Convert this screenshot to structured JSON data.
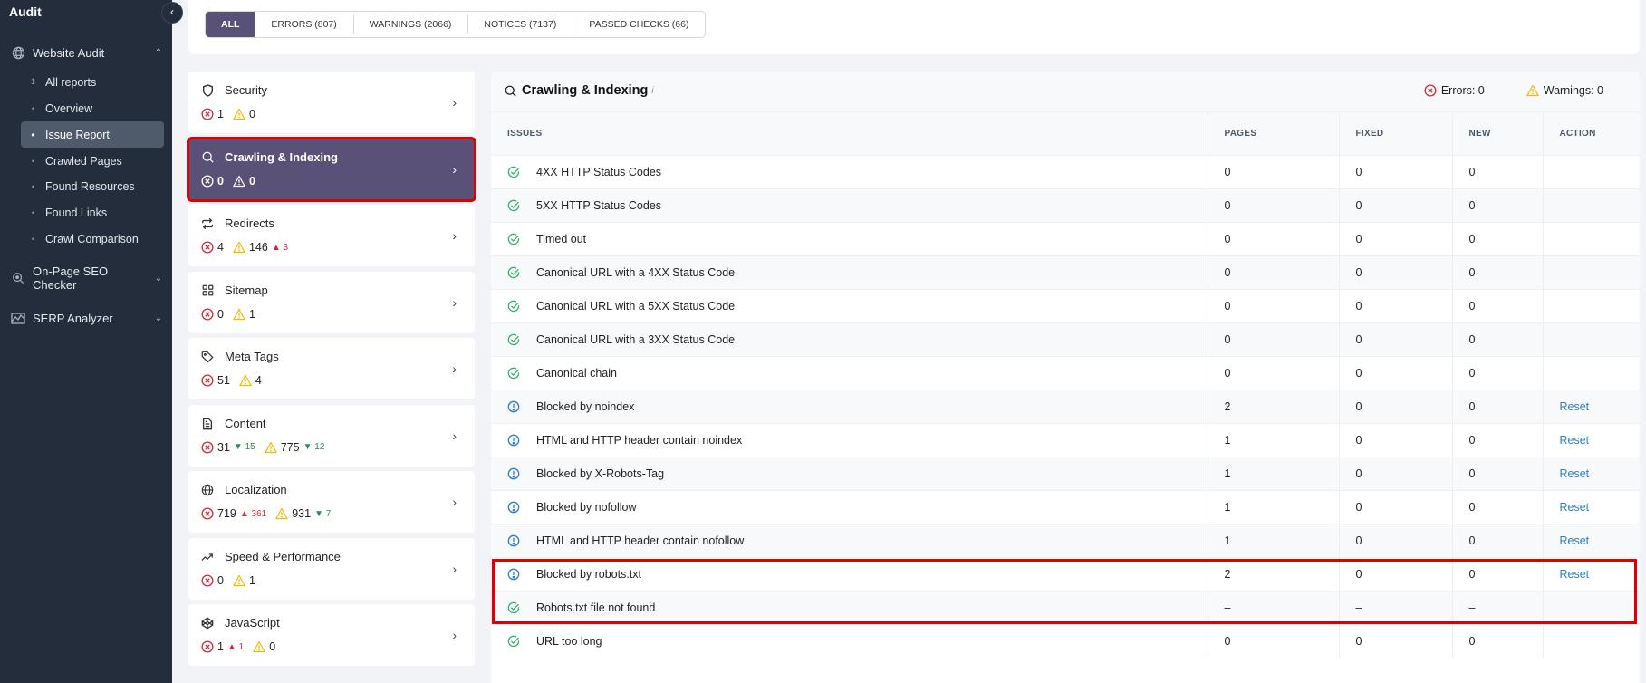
{
  "sidebar": {
    "brand": "Audit",
    "collapse_icon": "chevron-left",
    "groups": [
      {
        "label": "Website Audit",
        "icon": "globe",
        "expanded": true
      },
      {
        "label": "On-Page SEO Checker",
        "icon": "search-zoom",
        "expanded": false
      },
      {
        "label": "SERP Analyzer",
        "icon": "chart-mountain",
        "expanded": false
      }
    ],
    "items": [
      {
        "label": "All reports",
        "bullet": "↑"
      },
      {
        "label": "Overview",
        "bullet": "·"
      },
      {
        "label": "Issue Report",
        "bullet": "•",
        "active": true
      },
      {
        "label": "Crawled Pages",
        "bullet": "·"
      },
      {
        "label": "Found Resources",
        "bullet": "·"
      },
      {
        "label": "Found Links",
        "bullet": "·"
      },
      {
        "label": "Crawl Comparison",
        "bullet": "·"
      }
    ]
  },
  "tabs": [
    {
      "label": "ALL",
      "active": true
    },
    {
      "label": "ERRORS (807)"
    },
    {
      "label": "WARNINGS (2066)"
    },
    {
      "label": "NOTICES (7137)"
    },
    {
      "label": "PASSED CHECKS (66)"
    }
  ],
  "categories": [
    {
      "title": "Security",
      "icon": "shield",
      "errors": "1",
      "errors_delta": "",
      "warnings": "0",
      "warnings_delta": ""
    },
    {
      "title": "Crawling & Indexing",
      "icon": "search",
      "errors": "0",
      "errors_delta": "",
      "warnings": "0",
      "warnings_delta": "",
      "active": true
    },
    {
      "title": "Redirects",
      "icon": "repeat",
      "errors": "4",
      "errors_delta": "",
      "warnings": "146",
      "warnings_delta": "3",
      "warnings_delta_dir": "up"
    },
    {
      "title": "Sitemap",
      "icon": "grid",
      "errors": "0",
      "errors_delta": "",
      "warnings": "1",
      "warnings_delta": ""
    },
    {
      "title": "Meta Tags",
      "icon": "tag",
      "errors": "51",
      "errors_delta": "",
      "warnings": "4",
      "warnings_delta": ""
    },
    {
      "title": "Content",
      "icon": "document",
      "errors": "31",
      "errors_delta": "15",
      "errors_delta_dir": "down",
      "warnings": "775",
      "warnings_delta": "12",
      "warnings_delta_dir": "down"
    },
    {
      "title": "Localization",
      "icon": "globe",
      "errors": "719",
      "errors_delta": "361",
      "errors_delta_dir": "up",
      "warnings": "931",
      "warnings_delta": "7",
      "warnings_delta_dir": "down"
    },
    {
      "title": "Speed & Performance",
      "icon": "trend-up",
      "errors": "0",
      "errors_delta": "",
      "warnings": "1",
      "warnings_delta": ""
    },
    {
      "title": "JavaScript",
      "icon": "codepen",
      "errors": "1",
      "errors_delta": "1",
      "errors_delta_dir": "up",
      "warnings": "0",
      "warnings_delta": ""
    }
  ],
  "panel": {
    "title": "Crawling & Indexing",
    "info_mark": "i",
    "errors_label": "Errors: 0",
    "warnings_label": "Warnings: 0",
    "columns": [
      "ISSUES",
      "PAGES",
      "FIXED",
      "NEW",
      "ACTION"
    ],
    "rows": [
      {
        "status": "passed",
        "issue": "4XX HTTP Status Codes",
        "pages": "0",
        "fixed": "0",
        "new": "0",
        "action": ""
      },
      {
        "status": "passed",
        "issue": "5XX HTTP Status Codes",
        "pages": "0",
        "fixed": "0",
        "new": "0",
        "action": ""
      },
      {
        "status": "passed",
        "issue": "Timed out",
        "pages": "0",
        "fixed": "0",
        "new": "0",
        "action": ""
      },
      {
        "status": "passed",
        "issue": "Canonical URL with a 4XX Status Code",
        "pages": "0",
        "fixed": "0",
        "new": "0",
        "action": ""
      },
      {
        "status": "passed",
        "issue": "Canonical URL with a 5XX Status Code",
        "pages": "0",
        "fixed": "0",
        "new": "0",
        "action": ""
      },
      {
        "status": "passed",
        "issue": "Canonical URL with a 3XX Status Code",
        "pages": "0",
        "fixed": "0",
        "new": "0",
        "action": ""
      },
      {
        "status": "passed",
        "issue": "Canonical chain",
        "pages": "0",
        "fixed": "0",
        "new": "0",
        "action": ""
      },
      {
        "status": "notice",
        "issue": "Blocked by noindex",
        "pages": "2",
        "fixed": "0",
        "new": "0",
        "action": "Reset"
      },
      {
        "status": "notice",
        "issue": "HTML and HTTP header contain noindex",
        "pages": "1",
        "fixed": "0",
        "new": "0",
        "action": "Reset"
      },
      {
        "status": "notice",
        "issue": "Blocked by X-Robots-Tag",
        "pages": "1",
        "fixed": "0",
        "new": "0",
        "action": "Reset"
      },
      {
        "status": "notice",
        "issue": "Blocked by nofollow",
        "pages": "1",
        "fixed": "0",
        "new": "0",
        "action": "Reset"
      },
      {
        "status": "notice",
        "issue": "HTML and HTTP header contain nofollow",
        "pages": "1",
        "fixed": "0",
        "new": "0",
        "action": "Reset"
      },
      {
        "status": "notice",
        "issue": "Blocked by robots.txt",
        "pages": "2",
        "fixed": "0",
        "new": "0",
        "action": "Reset",
        "highlighted": true
      },
      {
        "status": "passed",
        "issue": "Robots.txt file not found",
        "pages": "–",
        "fixed": "–",
        "new": "–",
        "action": "",
        "highlighted": true
      },
      {
        "status": "passed",
        "issue": "URL too long",
        "pages": "0",
        "fixed": "0",
        "new": "0",
        "action": ""
      }
    ]
  },
  "colors": {
    "accent": "#5a5178",
    "sidebar_bg": "#232d3b",
    "error": "#d62839",
    "warning": "#f5b800",
    "passed": "#2fb36a",
    "notice": "#2d7ec4",
    "highlight": "#e00000"
  }
}
